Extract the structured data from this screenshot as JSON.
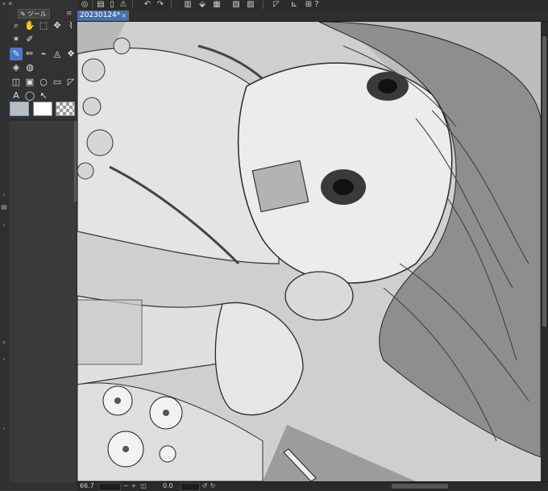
{
  "document": {
    "tab_title": "20230124*",
    "tab_close": "×"
  },
  "tool_panel": {
    "title": "ツール",
    "pen_glyph": "✎",
    "collapse_glyph": "«",
    "menu_glyph": "≡"
  },
  "tools": [
    {
      "name": "zoom",
      "glyph": "⌕"
    },
    {
      "name": "hand",
      "glyph": "✋"
    },
    {
      "name": "object-select",
      "glyph": "⬚"
    },
    {
      "name": "move",
      "glyph": "✥"
    },
    {
      "name": "eyedropper",
      "glyph": "⌇"
    },
    {
      "name": "auto-select",
      "glyph": "✶"
    },
    {
      "name": "dropper",
      "glyph": "✐"
    },
    {
      "name": "pen",
      "glyph": "✎"
    },
    {
      "name": "pencil",
      "glyph": "✏"
    },
    {
      "name": "brush",
      "glyph": "⌁"
    },
    {
      "name": "airbrush",
      "glyph": "◬"
    },
    {
      "name": "decoration",
      "glyph": "❖"
    },
    {
      "name": "eraser",
      "glyph": "◈"
    },
    {
      "name": "blend",
      "glyph": "◍"
    },
    {
      "name": "fill",
      "glyph": "◫"
    },
    {
      "name": "gradient",
      "glyph": "▣"
    },
    {
      "name": "figure",
      "glyph": "○"
    },
    {
      "name": "frame",
      "glyph": "▭"
    },
    {
      "name": "ruler",
      "glyph": "◸"
    },
    {
      "name": "text",
      "glyph": "A"
    },
    {
      "name": "balloon",
      "glyph": "◯"
    },
    {
      "name": "correct-line",
      "glyph": "↖"
    }
  ],
  "colors": {
    "main": "#bdbdbd",
    "sub": "#ffffff",
    "accent": "#4a78c8",
    "tab": "#4a6fa8"
  },
  "commands": [
    {
      "name": "home",
      "glyph": "◎"
    },
    {
      "name": "save",
      "glyph": "▤"
    },
    {
      "name": "new",
      "glyph": "▯"
    },
    {
      "name": "warning",
      "glyph": "⚠"
    },
    {
      "name": "undo",
      "glyph": "↶"
    },
    {
      "name": "redo",
      "glyph": "↷"
    },
    {
      "name": "clear",
      "glyph": "▥"
    },
    {
      "name": "fill",
      "glyph": "⬙"
    },
    {
      "name": "transform",
      "glyph": "▦"
    },
    {
      "name": "deselect",
      "glyph": "▧"
    },
    {
      "name": "invert",
      "glyph": "▨"
    },
    {
      "name": "ruler",
      "glyph": "◸"
    },
    {
      "name": "snap-ruler",
      "glyph": "⊾"
    },
    {
      "name": "snap-grid",
      "glyph": "⊞"
    },
    {
      "name": "help",
      "glyph": "?"
    }
  ],
  "status": {
    "zoom": "66.7",
    "angle": "0.0",
    "icons": [
      {
        "name": "zoom-out",
        "glyph": "−"
      },
      {
        "name": "zoom-in",
        "glyph": "+"
      },
      {
        "name": "fit",
        "glyph": "◫"
      },
      {
        "name": "rotate-left",
        "glyph": "↺"
      },
      {
        "name": "rotate-right",
        "glyph": "↻"
      }
    ]
  },
  "left_edge": [
    {
      "name": "collapse",
      "glyph": "«"
    },
    {
      "name": "arrow-up",
      "glyph": "˄"
    },
    {
      "name": "arrow-down",
      "glyph": "˅"
    },
    {
      "name": "layer-panel",
      "glyph": "▤"
    },
    {
      "name": "search",
      "glyph": "⌕"
    }
  ]
}
